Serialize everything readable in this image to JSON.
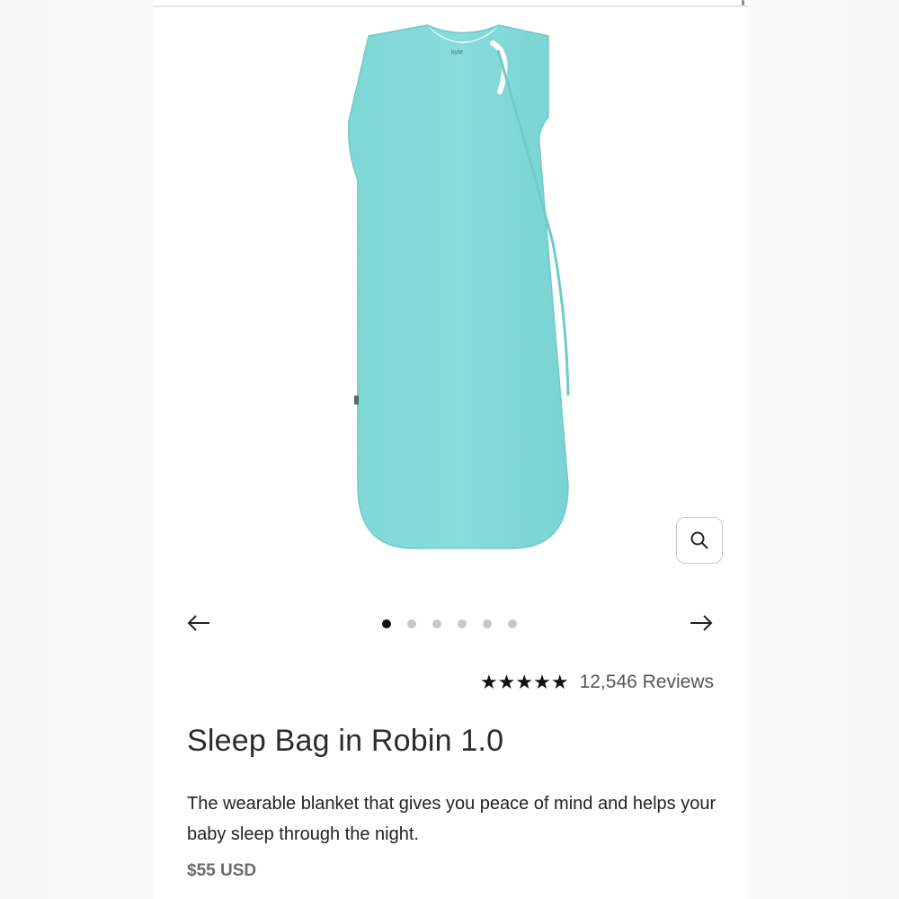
{
  "gallery": {
    "image_icon": "sleep-bag-product-image",
    "zoom_icon": "magnifier-icon",
    "prev_icon": "arrow-left-icon",
    "next_icon": "arrow-right-icon",
    "slide_count": 6,
    "active_slide": 1,
    "product_color": "#82d9d8"
  },
  "rating": {
    "stars": "★★★★★",
    "star_value": 5,
    "reviews_label": "12,546 Reviews"
  },
  "product": {
    "title": "Sleep Bag in Robin 1.0",
    "description": "The wearable blanket that gives you peace of mind and helps your baby sleep through the night.",
    "price": "$55 USD"
  }
}
